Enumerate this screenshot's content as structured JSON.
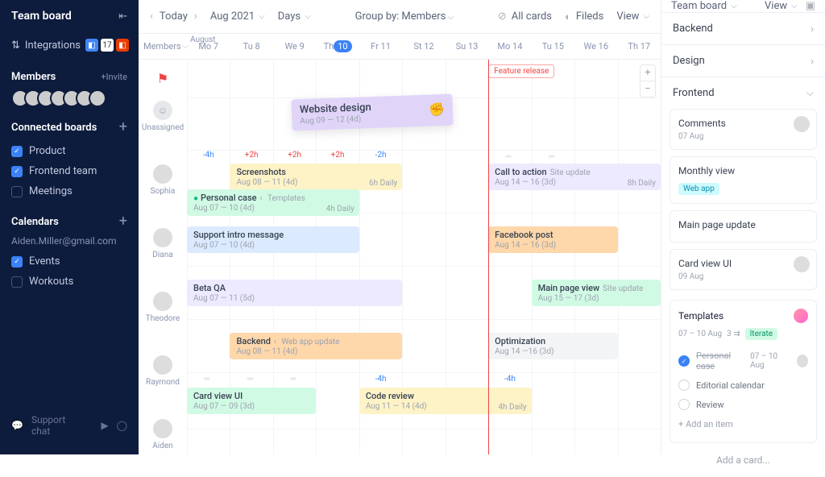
{
  "sidebar": {
    "title": "Team board",
    "integrations": "Integrations",
    "members_title": "Members",
    "invite": "+Invite",
    "connected_title": "Connected boards",
    "boards": [
      {
        "label": "Product",
        "checked": true
      },
      {
        "label": "Frontend team",
        "checked": true
      },
      {
        "label": "Meetings",
        "checked": false
      }
    ],
    "calendars_title": "Calendars",
    "email": "Aiden.Miller@gmail.com",
    "calendars": [
      {
        "label": "Events",
        "checked": true
      },
      {
        "label": "Workouts",
        "checked": false
      }
    ],
    "support": "Support chat"
  },
  "toolbar": {
    "today": "Today",
    "month": "Aug 2021",
    "scale": "Days",
    "group_label": "Group by:",
    "group_value": "Members",
    "all_cards": "All cards",
    "fields": "Fileds",
    "view": "View"
  },
  "timeline": {
    "members_label": "Members",
    "month_label": "August",
    "days": [
      "Mo 7",
      "Tu 8",
      "We 9",
      "Th 10",
      "Fr 11",
      "St 12",
      "Su 13",
      "Mo 14",
      "Tu 15",
      "We 16",
      "Th 17"
    ],
    "today_index": 3,
    "feature_release": "Feature release",
    "members": [
      {
        "name": "Unassigned"
      },
      {
        "name": "Sophia"
      },
      {
        "name": "Diana"
      },
      {
        "name": "Theodore"
      },
      {
        "name": "Raymond"
      },
      {
        "name": "Aiden"
      }
    ],
    "floating": {
      "title": "Website design",
      "sub": "Aug 09 — 12 (4d)"
    },
    "hours_r1": [
      "-4h",
      "+2h",
      "+2h",
      "+2h",
      "-2h"
    ],
    "hours_r5": [
      "-4h",
      "-4h"
    ],
    "cards": {
      "screenshots": {
        "title": "Screenshots",
        "sub": "Aug 08 — 11 (4d)",
        "daily": "6h Daily"
      },
      "personal": {
        "title": "Personal case",
        "sub": "Aug 07 — 10 (4d)",
        "link": "Templates",
        "daily": "4h Daily"
      },
      "cta": {
        "title": "Call to action",
        "sub": "Aug 14 — 16 (3d)",
        "link": "Site update",
        "daily": "8h Daily"
      },
      "support": {
        "title": "Support intro message",
        "sub": "Aug 07 — 10 (4d)"
      },
      "facebook": {
        "title": "Facebook post",
        "sub": "Aug 14 — 16 (3d)"
      },
      "betaqa": {
        "title": "Beta QA",
        "sub": "Aug 07 — 11 (5d)"
      },
      "mainpage": {
        "title": "Main page view",
        "sub": "Aug 15 — 17 (3d)",
        "link": "Site update"
      },
      "backend": {
        "title": "Backend",
        "sub": "Aug 08 — 11 (4d)",
        "link": "Web app update"
      },
      "optim": {
        "title": "Optimization",
        "sub": "Aug 14 —16 (3d)"
      },
      "cardview": {
        "title": "Card view UI",
        "sub": "Aug 07 — 09 (3d)"
      },
      "codereview": {
        "title": "Code review",
        "sub": "Aug 11 — 14 (4d)",
        "daily": "4h Daily"
      }
    }
  },
  "rpanel": {
    "board": "Team board",
    "view": "View",
    "sections": {
      "backend": "Backend",
      "design": "Design",
      "frontend": "Frontend"
    },
    "cards": [
      {
        "title": "Comments",
        "date": "07 Aug",
        "avatar": true
      },
      {
        "title": "Monthly view",
        "tag": "Web app"
      },
      {
        "title": "Main page update"
      },
      {
        "title": "Card view UI",
        "date": "09 Aug",
        "avatar": true
      }
    ],
    "templates": {
      "title": "Templates",
      "meta": "07 – 10 Aug",
      "subs": "3",
      "iterate": "Iterate",
      "items": [
        {
          "label": "Personal case",
          "done": true,
          "date": "07 – 10 Aug",
          "avatar": true
        },
        {
          "label": "Editorial calendar",
          "done": false
        },
        {
          "label": "Review",
          "done": false
        }
      ],
      "add_item": "+ Add an item"
    },
    "add_card": "Add a card..."
  }
}
